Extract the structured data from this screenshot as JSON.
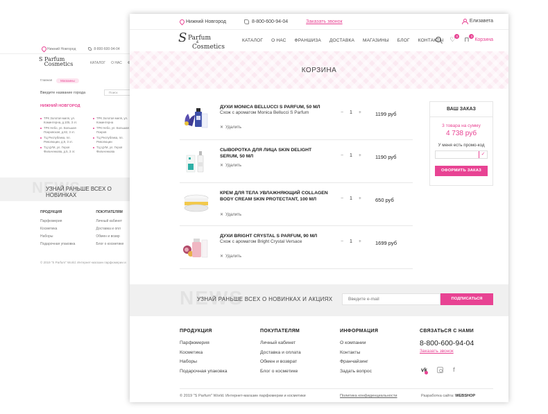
{
  "background_page": {
    "city": "Нижний Новгород",
    "phone": "8-800-600-94-04",
    "nav": [
      "КАТАЛОГ",
      "О НАС",
      "Ф"
    ],
    "breadcrumbs": [
      "Главная",
      "Магазины"
    ],
    "search_label": "Введите название города",
    "search_placeholder": "Поиск",
    "city_heading": "НИЖНИЙ НОВГОРОД",
    "stores": [
      "ТРК Золотая миля, ул. Коминтерна, д.105, 3 эт.",
      "ТРК Золотая миля, ул. Коминтерна",
      "ТРК Небо, ул. Большая Покровская, д.82, 3 эт.",
      "ТРК Небо, ул. Большая Покров",
      "ТЦ Республика, пл. Революции, д.9, 3 эт.",
      "ТЦ Республика, пл. Революции",
      "ТЦ ЦУМ, ул. Героя Фильченкова, д.5, 3 эт.",
      "ТЦ ЦУМ, ул. Героя Фильченкова"
    ],
    "newsletter_ghost": "NEWS",
    "newsletter_text": "УЗНАЙ РАНЬШЕ ВСЕХ О НОВИНКАХ",
    "footer_col1": {
      "title": "ПРОДУКЦИЯ",
      "links": [
        "Парфюмерия",
        "Косметика",
        "Наборы",
        "Подарочная упаковка"
      ]
    },
    "footer_col2": {
      "title": "ПОКУПАТЕЛЯМ",
      "links": [
        "Личный кабинет",
        "Доставка и опл",
        "Обмен и возвр",
        "Блог о косметике"
      ]
    },
    "copyright": "© 2019 \"S Parfum\" World. Интернет-магазин парфюмерии и"
  },
  "topbar": {
    "city": "Нижний Новгород",
    "phone": "8-800-600-94-04",
    "callback": "Заказать звонок",
    "user": "Елизавета"
  },
  "logo": {
    "s": "S",
    "parfum": "Parfum",
    "amp": "&",
    "cosmetics": "Cosmetics"
  },
  "nav": [
    "КАТАЛОГ",
    "О НАС",
    "ФРАНШИЗА",
    "ДОСТАВКА",
    "МАГАЗИНЫ",
    "БЛОГ",
    "КОНТАКТЫ"
  ],
  "header_icons": {
    "wishlist_count": "0",
    "cart_count": "3",
    "cart_label": "Корзина"
  },
  "banner_title": "КОРЗИНА",
  "cart_items": [
    {
      "name": "ДУХИ MONICA BELLUCCI S PARFUM, 50 МЛ",
      "subtitle": "Схож с ароматом Monica Bellucci S Parfum",
      "qty": "1",
      "price": "1199 руб",
      "delete": "Удалить"
    },
    {
      "name": "СЫВОРОТКА ДЛЯ ЛИЦА SKIN DELIGHT SERUM, 50 МЛ",
      "subtitle": "",
      "qty": "1",
      "price": "1190 руб",
      "delete": "Удалить"
    },
    {
      "name": "КРЕМ ДЛЯ ТЕЛА УВЛАЖНЯЮЩИЙ COLLAGEN BODY CREAM SKIN PROTECTANT, 100 МЛ",
      "subtitle": "",
      "qty": "1",
      "price": "650 руб",
      "delete": "Удалить"
    },
    {
      "name": "ДУХИ BRIGHT CRYSTAL S PARFUM, 90 МЛ",
      "subtitle": "Схож с ароматом Bright Crystal Versace",
      "qty": "1",
      "price": "1699 руб",
      "delete": "Удалить"
    }
  ],
  "qty_controls": {
    "minus": "−",
    "plus": "+"
  },
  "order": {
    "title": "ВАШ ЗАКАЗ",
    "summary": "3 товара на сумму",
    "total": "4 738 руб",
    "promo_label": "У меня есть промо-код",
    "promo_value": "",
    "submit": "ОФОРМИТЬ ЗАКАЗ"
  },
  "subscribe": {
    "ghost": "NEWS",
    "text": "УЗНАЙ РАНЬШЕ ВСЕХ О НОВИНКАХ И АКЦИЯХ",
    "placeholder": "Введите e-mail",
    "button": "ПОДПИСАТЬСЯ"
  },
  "footer": {
    "products": {
      "title": "ПРОДУКЦИЯ",
      "links": [
        "Парфюмерия",
        "Косметика",
        "Наборы",
        "Подарочная упаковка"
      ]
    },
    "customers": {
      "title": "ПОКУПАТЕЛЯМ",
      "links": [
        "Личный кабинет",
        "Доставка и оплата",
        "Обмен и возврат",
        "Блог о косметике"
      ]
    },
    "info": {
      "title": "ИНФОРМАЦИЯ",
      "links": [
        "О компании",
        "Контакты",
        "Франчайзинг",
        "Задать вопрос"
      ]
    },
    "contact": {
      "title": "СВЯЗАТЬСЯ С НАМИ",
      "phone": "8-800-600-94-04",
      "callback": "Заказать звонок"
    },
    "social": {
      "vk": "vk",
      "fb": "f"
    },
    "copyright": "© 2019 \"S Parfum\" World. Интернет-магазин парфюмерии и косметики",
    "policy": "Политика конфиденциальности",
    "dev_label": "Разработка сайта:",
    "dev_name": "WEBSHOP"
  },
  "colors": {
    "accent": "#e84393",
    "banner": "#fbe9f1",
    "band": "#f0f0f0"
  }
}
